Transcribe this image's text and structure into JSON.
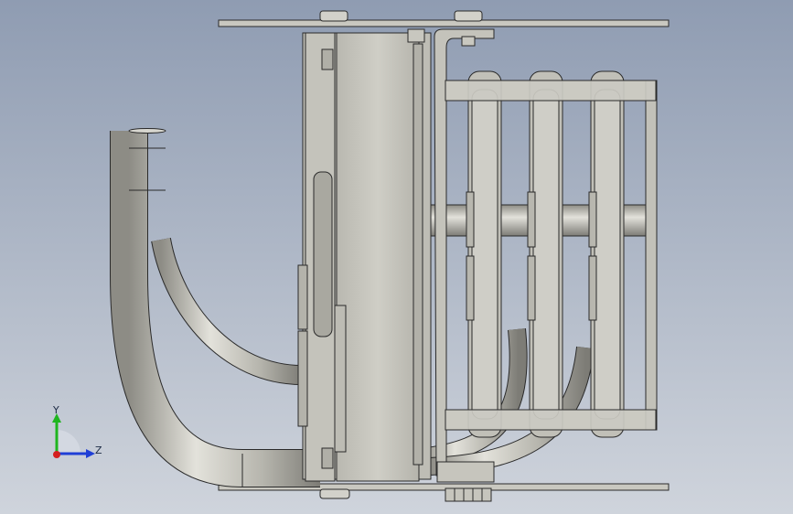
{
  "view": {
    "background_top": "#8f9cb2",
    "background_bottom": "#cfd4dc",
    "part_fill": "#c7c6bd",
    "part_edge": "#2a2a2a",
    "pipe_fill": "#bdbcb4"
  },
  "triad": {
    "y_label": "Y",
    "z_label": "Z",
    "y_color": "#1fb51f",
    "z_color": "#1f3fd6",
    "origin_color": "#d41f1f"
  }
}
